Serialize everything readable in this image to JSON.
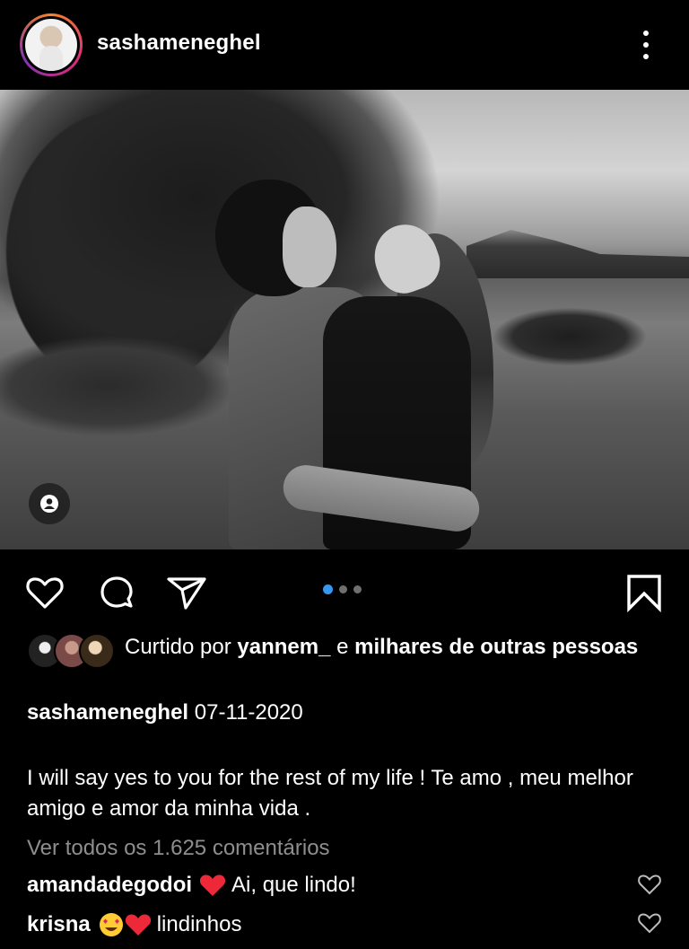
{
  "header": {
    "username": "sashameneghel"
  },
  "post": {
    "carousel": {
      "total": 3,
      "active": 0
    }
  },
  "likes": {
    "prefix": "Curtido por ",
    "user": "yannem_",
    "connector": " e ",
    "others": "milhares de outras pessoas"
  },
  "caption": {
    "username": "sashameneghel",
    "date": "07-11-2020",
    "text": "I will say yes to you for the rest of my life !  Te amo , meu melhor amigo e amor da minha vida ."
  },
  "comments": {
    "view_all": "Ver todos os 1.625 comentários",
    "items": [
      {
        "username": "amandadegodoi",
        "emoji": "❤️",
        "text": "Ai, que lindo!"
      },
      {
        "username": "krisna",
        "emoji": "😍❤️",
        "text": "lindinhos"
      }
    ]
  },
  "colors": {
    "background": "#000000",
    "text": "#ffffff",
    "muted": "#8e8e8e",
    "carousel_active": "#3897f0",
    "heart_red": "#ed2939"
  },
  "icons": [
    "kebab-menu-icon",
    "user-tag-icon",
    "heart-icon",
    "comment-icon",
    "share-icon",
    "bookmark-icon",
    "comment-like-heart-icon"
  ]
}
